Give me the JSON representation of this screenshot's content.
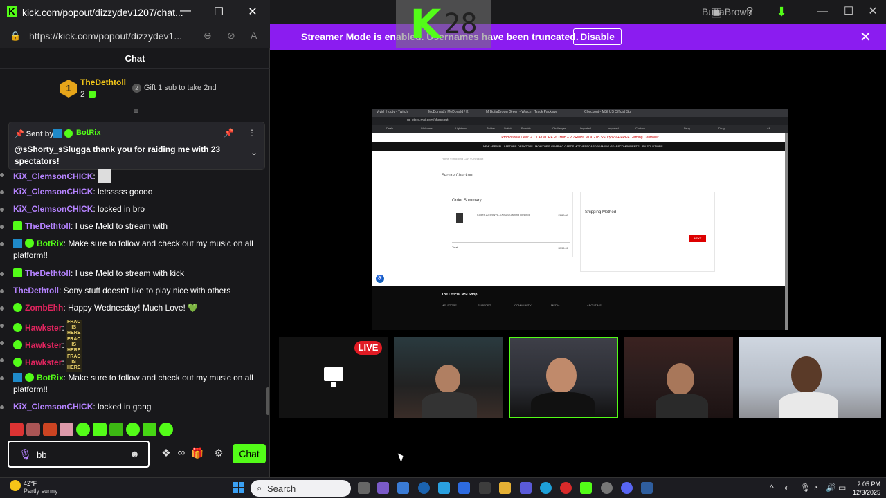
{
  "browser_popout": {
    "window_title": "kick.com/popout/dizzydev1207/chat...",
    "url": "https://kick.com/popout/dizzydev1...",
    "chat_header": "Chat",
    "leader": {
      "rank": "1",
      "name": "TheDethtoll",
      "count": "2",
      "next_rank": "2",
      "gift_text": "Gift 1 sub to take 2nd"
    },
    "pinned": {
      "sent_by": "Sent by",
      "user": "BotRix",
      "message": "@sShorty_sSlugga thank you for raiding me with 23 spectators!"
    },
    "messages": [
      {
        "user": "KiX_ClemsonCHICK",
        "text": ":",
        "color": "purple",
        "badges": [],
        "emote": "cup"
      },
      {
        "user": "KiX_ClemsonCHICK",
        "text": ": letsssss goooo",
        "color": "purple",
        "badges": []
      },
      {
        "user": "KiX_ClemsonCHICK",
        "text": ": locked in bro",
        "color": "purple",
        "badges": []
      },
      {
        "user": "TheDethtoll",
        "text": ": I use Meld to stream with",
        "color": "purple",
        "badges": [
          "sub"
        ]
      },
      {
        "user": "BotRix",
        "text": ": Make sure to follow and check out my music on all platform!!",
        "color": "green",
        "badges": [
          "bot",
          "ver"
        ]
      },
      {
        "user": "TheDethtoll",
        "text": ": I use Meld to stream with kick",
        "color": "purple",
        "badges": [
          "sub"
        ]
      },
      {
        "user": "TheDethtoll",
        "text": ": Sony stuff doesn't like to play nice with others",
        "color": "purple",
        "badges": []
      },
      {
        "user": "ZombEhh",
        "text": ": Happy Wednesday! Much Love! 💚",
        "color": "red",
        "badges": [
          "ver"
        ]
      },
      {
        "user": "Hawkster",
        "text": ":",
        "color": "red",
        "badges": [
          "ver"
        ],
        "frac": "FRAC IS HERE"
      },
      {
        "user": "Hawkster",
        "text": ":",
        "color": "red",
        "badges": [
          "ver"
        ],
        "frac": "FRAC IS HERE"
      },
      {
        "user": "Hawkster",
        "text": ":",
        "color": "red",
        "badges": [
          "ver"
        ],
        "frac": "FRAC IS HERE"
      },
      {
        "user": "BotRix",
        "text": ": Make sure to follow and check out my music on all platform!!",
        "color": "green",
        "badges": [
          "bot",
          "ver"
        ]
      },
      {
        "user": "KiX_ClemsonCHICK",
        "text": ": locked in gang",
        "color": "purple",
        "badges": []
      }
    ],
    "input_value": "bb",
    "chat_button": "Chat"
  },
  "stage": {
    "logo_text": "28",
    "topbar_name": "ButtaBrown",
    "banner_text": "Streamer Mode is enabled. Usernames have been truncated.",
    "banner_button": "Disable",
    "live_badge": "LIVE"
  },
  "shared_screen": {
    "tabs": [
      "Vivid_Hooty - Twitch",
      "McDonald's MeDonald / K",
      "MrButtaBrown Green - Watch",
      "Track Package",
      "Checkout - MSI US Official Su"
    ],
    "url": "us-store.msi.com/checkout",
    "promo": "Promotional Deal: ✓ CLAYMORE PC Hub + 2.7RMHz MLX 2TB SSD $329 + FREE Gaming Controller",
    "nav": [
      "NEW ARRIVAL",
      "LAPTOPS",
      "DESKTOPS",
      "MONITORS",
      "GRAPHIC CARDS",
      "MOTHERBOARDS",
      "GAMING GEARS",
      "COMPONENTS",
      "BY SOLUTIONS"
    ],
    "breadcrumb": "Home  ›  Shopping Cart  ›  Checkout",
    "secure_checkout": "Secure Checkout",
    "order_summary": "Order Summary",
    "item": "Codex Z2 B9NVL-XXXUS Gaming Desktop",
    "item_price": "$999.00",
    "total_label": "Total",
    "total": "$999.00",
    "shipping_method": "Shipping Method",
    "next_button": "NEXT",
    "footer_title": "The Official MSI Shop",
    "footer_cols": [
      "MSI STORE",
      "SUPPORT",
      "COMMUNITY",
      "MEDIA",
      "ABOUT MSI"
    ]
  },
  "taskbar": {
    "temperature": "42°F",
    "weather": "Partly sunny",
    "search": "Search",
    "time": "2:05 PM",
    "date": "12/3/2025"
  }
}
